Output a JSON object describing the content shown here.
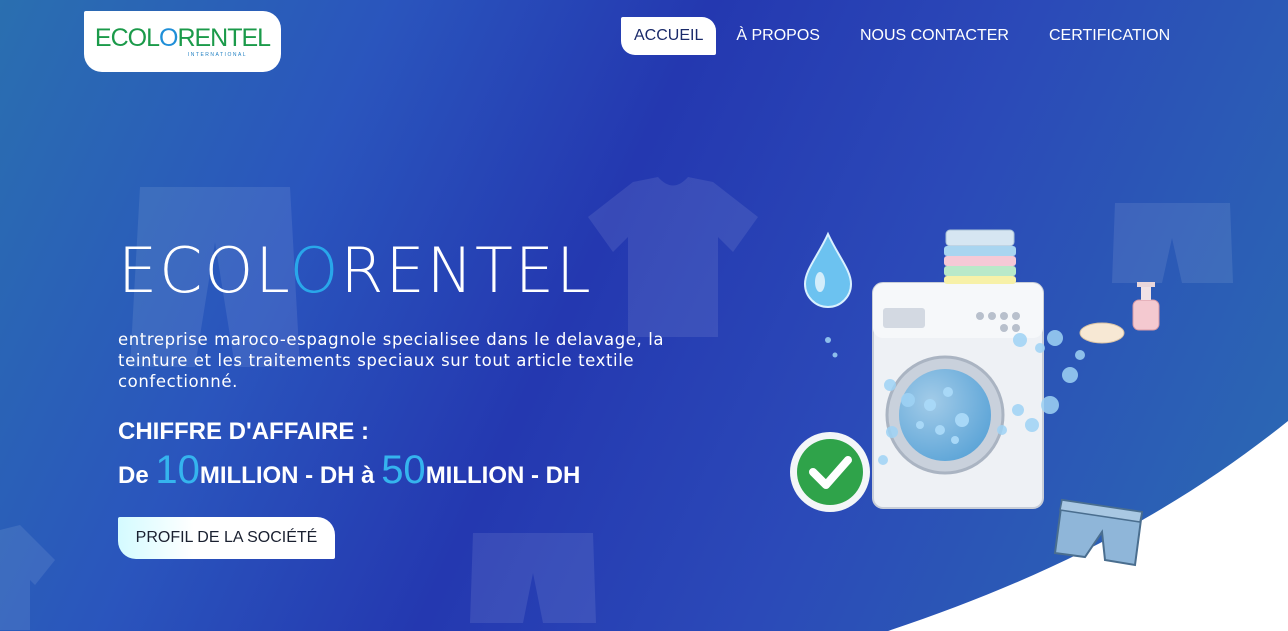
{
  "header": {
    "logo": {
      "text_pre": "ECOL",
      "text_o": "O",
      "text_post": "RENTEL",
      "subtitle": "INTERNATIONAL"
    },
    "nav": [
      {
        "label": "ACCUEIL",
        "active": true
      },
      {
        "label": "À PROPOS",
        "active": false
      },
      {
        "label": "NOUS CONTACTER",
        "active": false
      },
      {
        "label": "CERTIFICATION",
        "active": false
      }
    ]
  },
  "hero": {
    "title_pre": "ECOL",
    "title_o": "O",
    "title_post": "RENTEL",
    "description": "entreprise maroco-espagnole specialisee dans le delavage, la teinture et les traitements speciaux sur tout article textile confectionné.",
    "revenue_label": "CHIFFRE D'AFFAIRE :",
    "revenue_prefix": "De ",
    "revenue_min": "10",
    "revenue_unit1": "MILLION - DH à ",
    "revenue_max": "50",
    "revenue_unit2": "MILLION - DH",
    "profile_button": "PROFIL DE LA SOCIÉTÉ"
  },
  "colors": {
    "accent": "#29a7ea",
    "logo_green": "#1b9a4a",
    "bg_primary": "#2438b0"
  },
  "icons": [
    "washing-machine-icon",
    "water-drop-icon",
    "check-badge-icon",
    "shorts-icon",
    "soap-bottle-icon",
    "tshirt-icon"
  ]
}
